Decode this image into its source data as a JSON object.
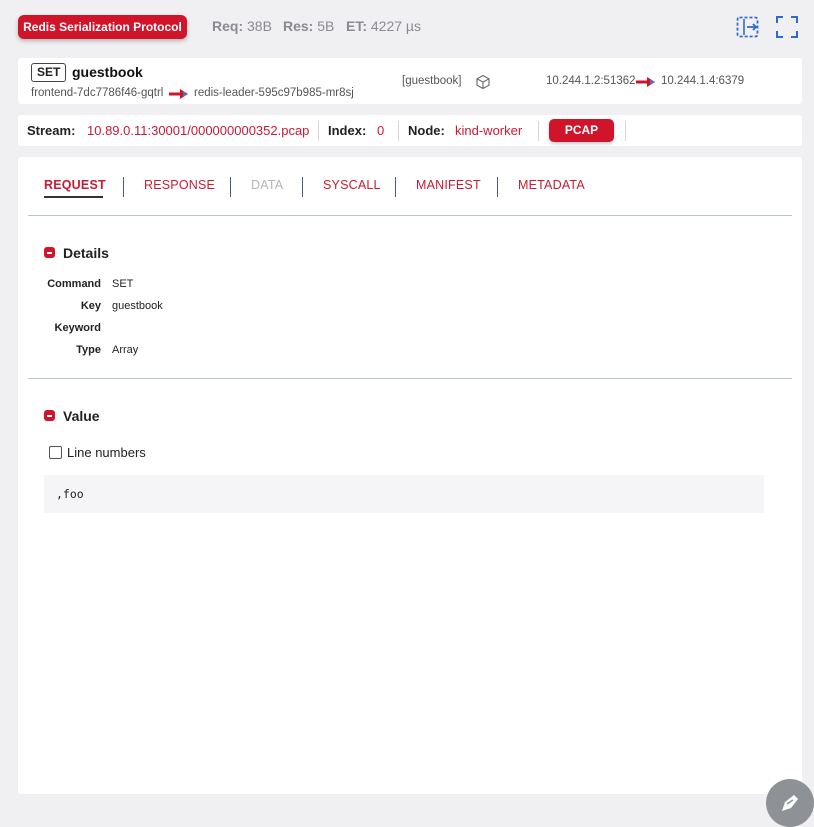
{
  "header": {
    "protocol": "Redis Serialization Protocol",
    "req_label": "Req:",
    "req_value": "38B",
    "res_label": "Res:",
    "res_value": "5B",
    "et_label": "ET:",
    "et_value": "4227 µs"
  },
  "summary": {
    "method": "SET",
    "path": "guestbook",
    "source_name": "frontend-7dc7786f46-gqtrl",
    "dest_name": "redis-leader-595c97b985-mr8sj",
    "summary_tag": "[guestbook]",
    "source_ip": "10.244.1.2:51362",
    "dest_ip": "10.244.1.4:6379"
  },
  "stream": {
    "stream_label": "Stream:",
    "stream_value": "10.89.0.11:30001/000000000352.pcap",
    "index_label": "Index:",
    "index_value": "0",
    "node_label": "Node:",
    "node_value": "kind-worker",
    "pcap_button": "PCAP"
  },
  "tabs": [
    {
      "label": "REQUEST"
    },
    {
      "label": "RESPONSE"
    },
    {
      "label": "DATA"
    },
    {
      "label": "SYSCALL"
    },
    {
      "label": "MANIFEST"
    },
    {
      "label": "METADATA"
    }
  ],
  "details": {
    "title": "Details",
    "rows": [
      {
        "key": "Command",
        "value": "SET"
      },
      {
        "key": "Key",
        "value": "guestbook"
      },
      {
        "key": "Keyword",
        "value": ""
      },
      {
        "key": "Type",
        "value": "Array"
      }
    ]
  },
  "value_section": {
    "title": "Value",
    "line_numbers_label": "Line numbers",
    "line_numbers_checked": false,
    "content": ",foo"
  },
  "colors": {
    "accent": "#d0152b",
    "link": "#c81b34",
    "icon_blue": "#2f6ad0"
  }
}
